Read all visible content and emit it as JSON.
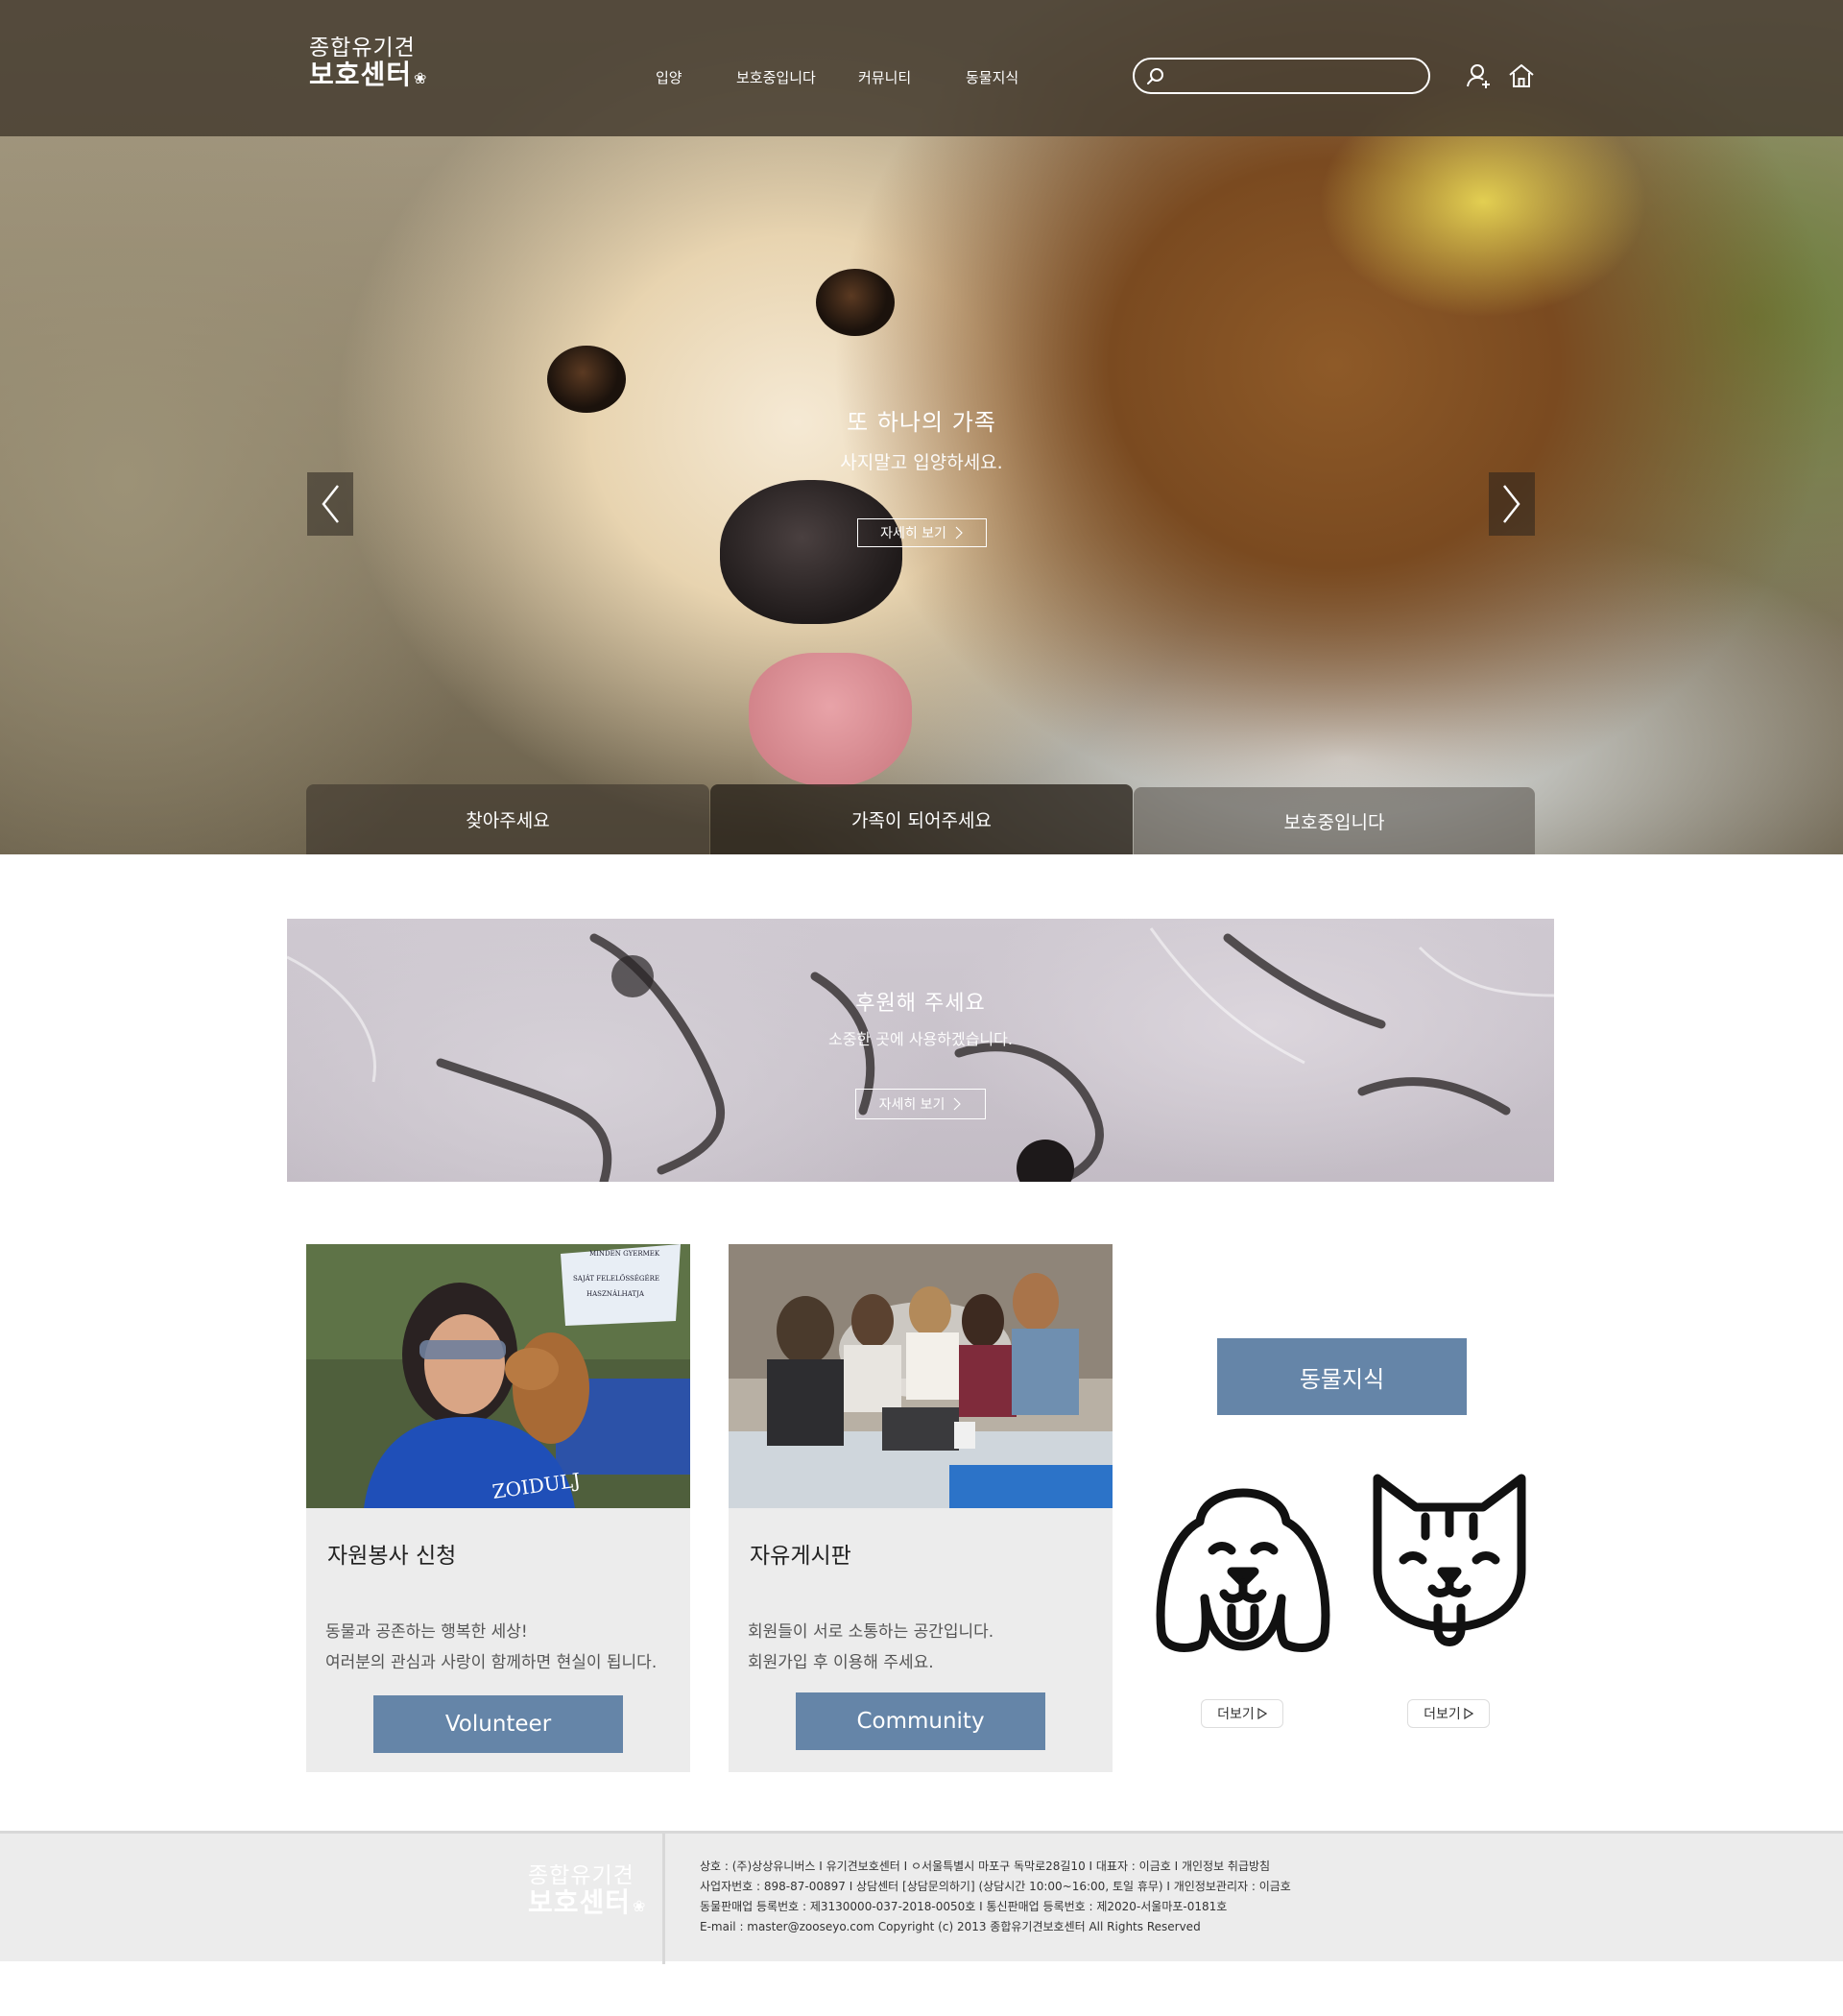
{
  "header": {
    "logo_top": "종합유기견",
    "logo_bottom": "보호센터",
    "nav": [
      "입양",
      "보호중입니다",
      "커뮤니티",
      "동물지식"
    ],
    "search_placeholder": ""
  },
  "icons": {
    "search": "search-icon",
    "user": "user-add-icon",
    "home": "home-icon",
    "prev": "chevron-left-icon",
    "next": "chevron-right-icon",
    "more_arrow": "chevron-right-icon"
  },
  "hero": {
    "title": "또 하나의 가족",
    "subtitle": "사지말고 입양하세요.",
    "more_label": "자세히 보기",
    "tabs": [
      "찾아주세요",
      "가족이 되어주세요",
      "보호중입니다"
    ]
  },
  "support": {
    "title": "후원해 주세요",
    "subtitle": "소중한 곳에 사용하겠습니다.",
    "more_label": "자세히 보기"
  },
  "cards": [
    {
      "title": "자원봉사 신청",
      "desc_line1": "동물과 공존하는 행복한 세상!",
      "desc_line2": "여러분의 관심과 사랑이 함께하면 현실이 됩니다.",
      "button": "Volunteer",
      "photo_text": [
        "MINDEN GYERMEK",
        "SAJÁT FELELŐSSÉGÉRE",
        "HASZNÁLHATJA"
      ],
      "shirt_text": "ZOIDULJ"
    },
    {
      "title": "자유게시판",
      "desc_line1": "회원들이 서로 소통하는 공간입니다.",
      "desc_line2": "회원가입 후 이용해 주세요.",
      "button": "Community"
    }
  ],
  "animal_knowledge": {
    "title": "동물지식",
    "dog_more": "더보기",
    "cat_more": "더보기"
  },
  "footer": {
    "logo_top": "종합유기견",
    "logo_bottom": "보호센터",
    "line1": "상호 : (주)상상유니버스 I 유기견보호센터 I ㅇ서울특별시 마포구 독막로28길10 I 대표자 : 이금호 I 개인정보 취급방침",
    "line2": "사업자번호 : 898-87-00897 I 상담센터 [상담문의하기] (상담시간 10:00~16:00, 토일 휴무) I 개인정보관리자 : 이금호",
    "line3": "동물판매업 등록번호 : 제3130000-037-2018-0050호 I 통신판매업 등록번호 : 제2020-서울마포-0181호",
    "line4": "E-mail : master@zooseyo.com Copyright (c) 2013 종합유기견보호센터 All Rights Reserved"
  },
  "colors": {
    "accent": "#6585a8",
    "topbar": "#463c30",
    "card_bg": "#ececec",
    "footer_bg": "#ececec"
  }
}
